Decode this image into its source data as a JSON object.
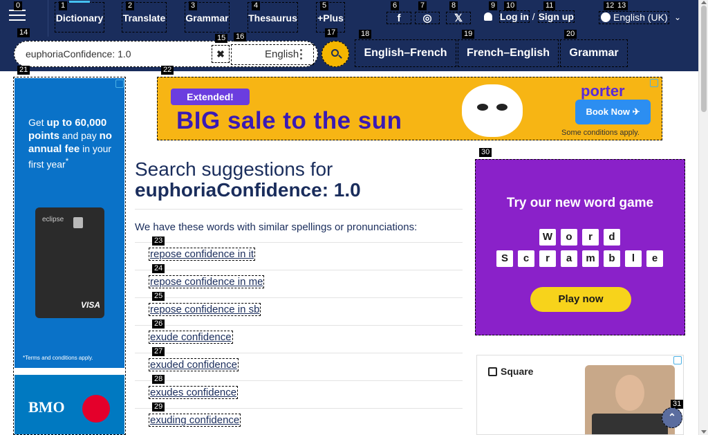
{
  "header": {
    "nav": [
      {
        "label": "Dictionary",
        "badge": "1"
      },
      {
        "label": "Translate",
        "badge": "2"
      },
      {
        "label": "Grammar",
        "badge": "3"
      },
      {
        "label": "Thesaurus",
        "badge": "4"
      },
      {
        "label": "+Plus",
        "badge": "5"
      }
    ],
    "menu_badge": "0",
    "social": [
      {
        "icon": "facebook-icon",
        "glyph": "f",
        "badge": "6"
      },
      {
        "icon": "instagram-icon",
        "glyph": "◎",
        "badge": "7"
      },
      {
        "icon": "x-twitter-icon",
        "glyph": "𝕏",
        "badge": "8"
      }
    ],
    "login_label": "Log in",
    "login_badge": "10",
    "user_badge": "9",
    "separator": "/",
    "signup_label": "Sign up",
    "signup_badge": "11",
    "language_label": "English (UK)",
    "language_badges": [
      "12",
      "13"
    ]
  },
  "search": {
    "badge": "14",
    "value": "euphoriaConfidence: 1.0",
    "clear_badge": "15",
    "clear_glyph": "✖",
    "dictionary_select": "English",
    "dictionary_badge": "16",
    "search_badge": "17"
  },
  "subnav": [
    {
      "label": "English–French",
      "badge": "18"
    },
    {
      "label": "French–English",
      "badge": "19"
    },
    {
      "label": "Grammar",
      "badge": "20"
    }
  ],
  "ads": {
    "left": {
      "badge": "21",
      "text_line1": "Get ",
      "text_bold": "up to 60,000 points",
      "text_line2": " and pay ",
      "text_bold2": "no annual fee",
      "text_line3": " in your first year",
      "text_sup": "*",
      "card_name": "eclipse",
      "card_brand": "VISA",
      "terms": "*Terms and conditions apply.",
      "bank": "BMO"
    },
    "top": {
      "badge": "22",
      "tag": "Extended!",
      "headline": "BIG sale to the sun",
      "brand": "porter",
      "cta": "Book Now ✈",
      "conditions": "Some conditions apply."
    },
    "right": {
      "badge": "30",
      "heading": "Try our new word game",
      "row1": [
        "W",
        "o",
        "r",
        "d"
      ],
      "row2": [
        "S",
        "c",
        "r",
        "a",
        "m",
        "b",
        "l",
        "e"
      ],
      "cta": "Play now"
    },
    "square": {
      "brand": "Square"
    }
  },
  "main": {
    "title_prefix": "Search suggestions for",
    "title_query": "euphoriaConfidence: 1.0",
    "intro": "We have these words with similar spellings or pronunciations:",
    "suggestions": [
      {
        "text": "repose confidence in it",
        "badge": "23"
      },
      {
        "text": "repose confidence in me",
        "badge": "24"
      },
      {
        "text": "repose confidence in sb",
        "badge": "25"
      },
      {
        "text": "exude confidence",
        "badge": "26"
      },
      {
        "text": "exuded confidence",
        "badge": "27"
      },
      {
        "text": "exudes confidence",
        "badge": "28"
      },
      {
        "text": "exuding confidence",
        "badge": "29"
      }
    ]
  },
  "back_to_top": {
    "badge": "31",
    "glyph": "⌃"
  },
  "colors": {
    "header_bg": "#1a2d5c",
    "accent_yellow": "#f5b600",
    "link": "#1a2d5c",
    "game_ad_bg": "#8a21c9"
  }
}
